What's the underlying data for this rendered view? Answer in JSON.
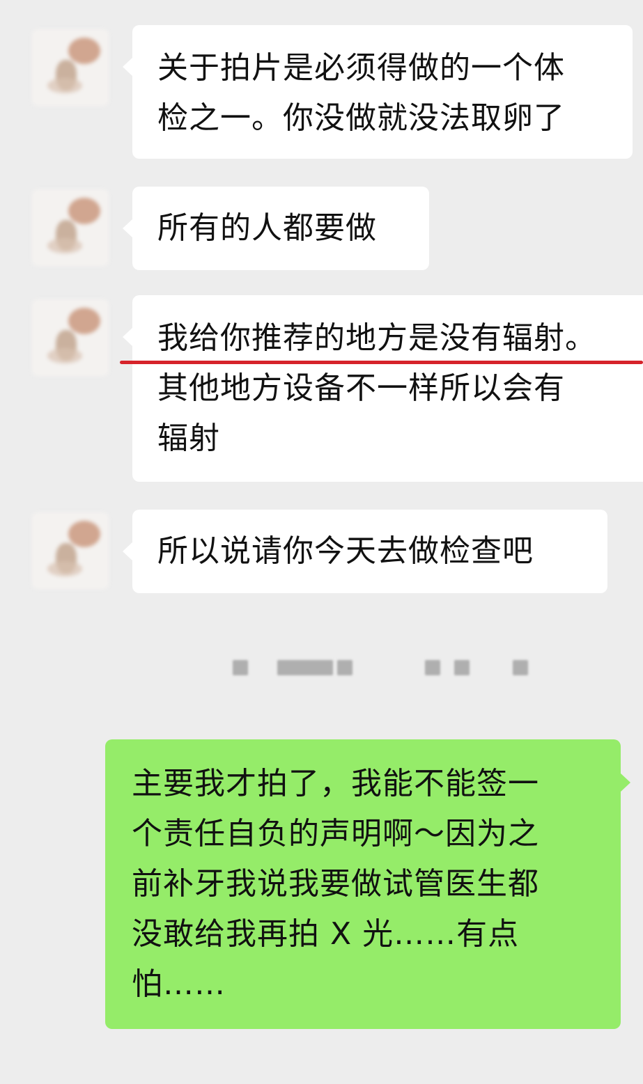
{
  "chat": {
    "messages": [
      {
        "sender": "contact",
        "lines": [
          "关于拍片是必须得做的一个体",
          "检之一。你没做就没法取卵了"
        ]
      },
      {
        "sender": "contact",
        "lines": [
          "所有的人都要做"
        ]
      },
      {
        "sender": "contact",
        "lines": [
          "我给你推荐的地方是没有辐射。",
          "其他地方设备不一样所以会有",
          "辐射"
        ]
      },
      {
        "sender": "contact",
        "lines": [
          "所以说请你今天去做检查吧"
        ]
      },
      {
        "sender": "me",
        "lines": [
          "主要我才拍了，我能不能签一",
          "个责任自负的声明啊～因为之",
          "前补牙我说我要做试管医生都",
          "没敢给我再拍 X 光……有点",
          "怕……"
        ]
      }
    ]
  },
  "colors": {
    "background": "#ededed",
    "incoming_bubble": "#ffffff",
    "outgoing_bubble": "#95ec69",
    "highlight_underline": "#d6232a"
  }
}
